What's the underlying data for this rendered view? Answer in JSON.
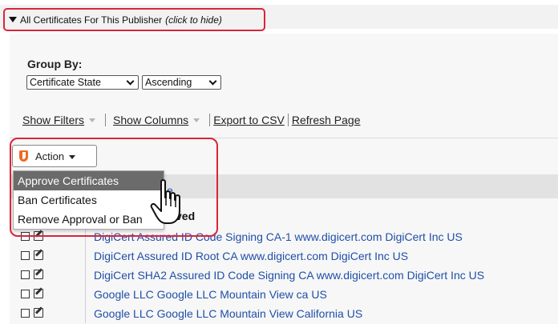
{
  "toggle": {
    "label": "All Certificates For This Publisher",
    "hint": "(click to hide)"
  },
  "group_by": {
    "label": "Group By:",
    "state_select": "Certificate State",
    "order_select": "Ascending"
  },
  "links": {
    "show_filters": "Show Filters",
    "show_columns": "Show Columns",
    "export_csv": "Export to CSV",
    "refresh": "Refresh Page"
  },
  "action": {
    "label": "Action",
    "menu": [
      "Approve Certificates",
      "Ban Certificates",
      "Remove Approval or Ban"
    ]
  },
  "table": {
    "column_name_partial": "e",
    "group_partial": "roved",
    "rows": [
      "DigiCert Assured ID Code Signing CA-1 www.digicert.com DigiCert Inc US",
      "DigiCert Assured ID Root CA www.digicert.com DigiCert Inc US",
      "DigiCert SHA2 Assured ID Code Signing CA www.digicert.com DigiCert Inc US",
      "Google LLC Google LLC Mountain View ca US",
      "Google LLC Google LLC Mountain View California US"
    ]
  },
  "colors": {
    "highlight": "#d9253a",
    "link": "#1f4fa8",
    "menu_active": "#6b6b6b",
    "shield": "#f06a1f"
  }
}
